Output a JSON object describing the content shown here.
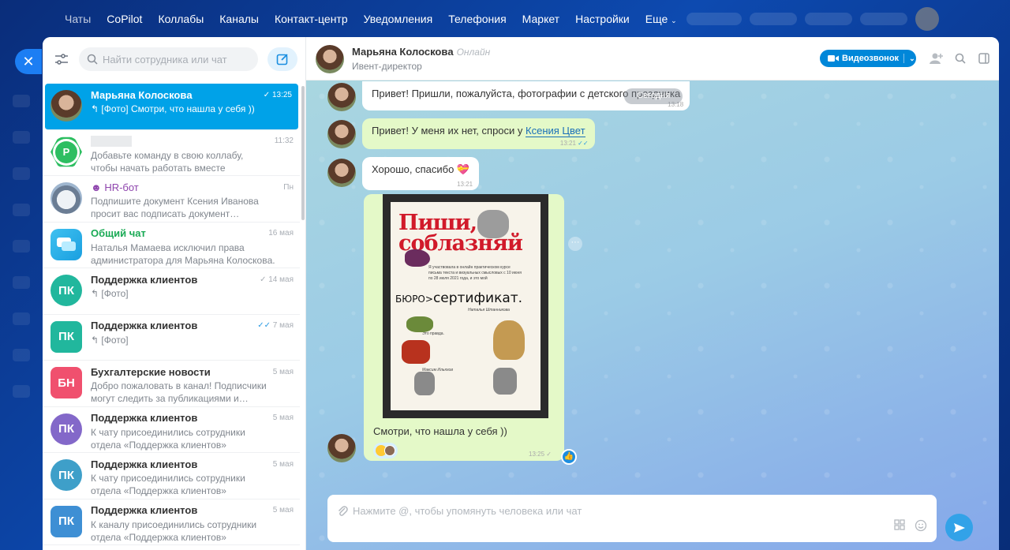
{
  "nav": {
    "items": [
      "Чаты",
      "CoPilot",
      "Коллабы",
      "Каналы",
      "Контакт-центр",
      "Уведомления",
      "Телефония",
      "Маркет",
      "Настройки",
      "Еще"
    ]
  },
  "sidebar": {
    "search_placeholder": "Найти сотрудника или чат",
    "chats": [
      {
        "name": "Марьяна Колосковa",
        "time": "13:25",
        "preview": "[Фото] Смотри, что нашла у себя ))",
        "active": true,
        "check": "✓"
      },
      {
        "name": "",
        "time": "11:32",
        "preview": "Добавьте команду в свою коллабу,",
        "preview2": "чтобы начать работать вместе",
        "initials": "P",
        "color": "#2dbe61"
      },
      {
        "name": "HR-бот",
        "time": "Пн",
        "preview": "Подпишите документ Ксения Иванова",
        "preview2": "просит вас подписать документ…",
        "color": "#8e44ad"
      },
      {
        "name": "Общий чат",
        "time": "16 мая",
        "preview": "Наталья Мамаева исключил права",
        "preview2": "администратора для Марьяна Колосковa.",
        "color": "#1aaa55"
      },
      {
        "name": "Поддержка клиентов",
        "time": "14 мая",
        "preview": "[Фото]",
        "initials": "ПК",
        "color": "#21b79d",
        "check": "✓"
      },
      {
        "name": "Поддержка клиентов",
        "time": "7 мая",
        "preview": "[Фото]",
        "initials": "ПК",
        "color": "#21b79d",
        "check": "✓✓"
      },
      {
        "name": "Бухгалтерские новости",
        "time": "5 мая",
        "preview": "Добро пожаловать в канал! Подписчики",
        "preview2": "могут следить за публикациями и…",
        "initials": "БН",
        "color": "#f0506e"
      },
      {
        "name": "Поддержка клиентов",
        "time": "5 мая",
        "preview": "К чату присоединились сотрудники",
        "preview2": "отдела «Поддержка клиентов»",
        "initials": "ПК",
        "color": "#8368c9"
      },
      {
        "name": "Поддержка клиентов",
        "time": "5 мая",
        "preview": "К чату присоединились сотрудники",
        "preview2": "отдела «Поддержка клиентов»",
        "initials": "ПК",
        "color": "#3e9fc9"
      },
      {
        "name": "Поддержка клиентов",
        "time": "5 мая",
        "preview": "К каналу присоединились сотрудники",
        "preview2": "отдела «Поддержка клиентов»",
        "initials": "ПК",
        "color": "#3e8fd4"
      }
    ]
  },
  "chat": {
    "name": "Марьяна Колосковa",
    "status": "Онлайн",
    "role": "Ивент-директор",
    "video_label": "Видеозвонок",
    "date_chip": "Сегодня",
    "messages": [
      {
        "text": "Привет! Пришли, пожалуйста, фотографии с детского праздника",
        "time": "13:18"
      },
      {
        "text": "Привет! У меня их нет, спроси у ",
        "link": "Ксения Цвет",
        "time": "13:21"
      },
      {
        "text": "Хорошо, спасибо 💝",
        "time": "13:21"
      },
      {
        "caption": "Смотри, что нашла у себя ))",
        "time": "13:25"
      }
    ],
    "certificate": {
      "title1": "Пиши,",
      "title2": "соблазняй",
      "small_text": "Я участвовала в онлайн практическом курсе письма текста и визуальных смысловых с 10 июня по 28 июля 2021 года, и это мой",
      "brand": "БЮРО>",
      "word": "сертификат.",
      "signer1": "Наталья Штанникова",
      "note": "Это правда.",
      "signer2": "Максим Ильяхов"
    },
    "input_placeholder": "Нажмите @, чтобы упомянуть человека или чат"
  }
}
